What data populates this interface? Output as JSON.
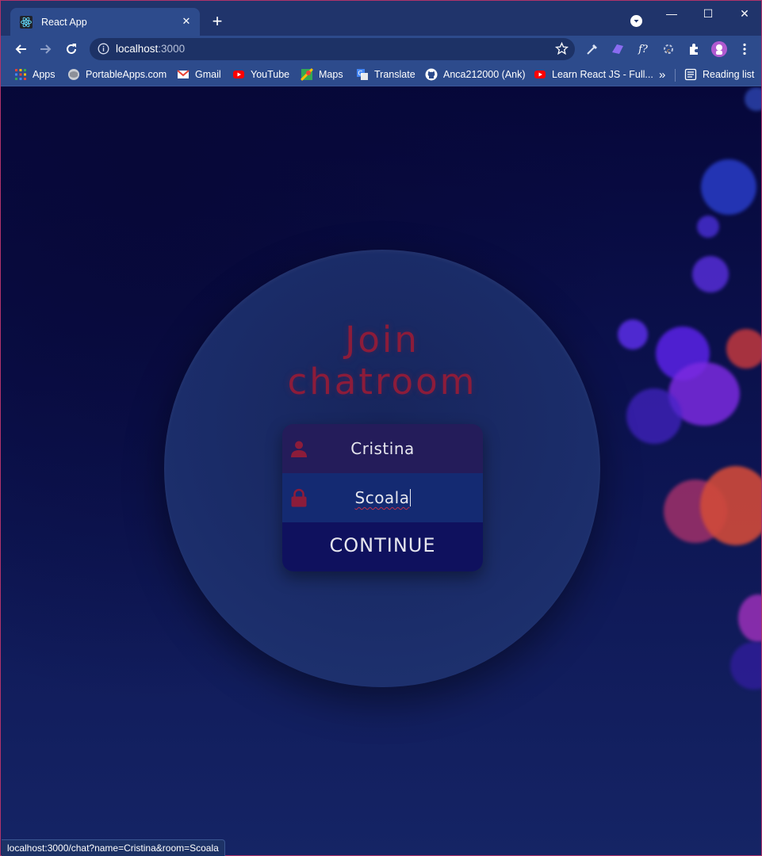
{
  "browser": {
    "tab_title": "React App",
    "url_host": "localhost",
    "url_port": ":3000",
    "bookmarks": [
      {
        "label": "Apps",
        "icon": "apps-grid-icon"
      },
      {
        "label": "PortableApps.com",
        "icon": "portableapps-icon"
      },
      {
        "label": "Gmail",
        "icon": "gmail-icon"
      },
      {
        "label": "YouTube",
        "icon": "youtube-icon"
      },
      {
        "label": "Maps",
        "icon": "maps-icon"
      },
      {
        "label": "Translate",
        "icon": "translate-icon"
      },
      {
        "label": "Anca212000 (Ank)",
        "icon": "github-icon"
      },
      {
        "label": "Learn React JS - Full...",
        "icon": "youtube-icon"
      }
    ],
    "overflow_label": "»",
    "reading_list": "Reading list",
    "status_url": "localhost:3000/chat?name=Cristina&room=Scoala"
  },
  "join": {
    "heading_line1": "Join",
    "heading_line2": "chatroom",
    "name_value": "Cristina",
    "room_value": "Scoala",
    "continue_label": "CONTINUE"
  },
  "colors": {
    "accent": "#8c1c3a",
    "background": "#0a0e3f",
    "button": "#0f115e"
  }
}
